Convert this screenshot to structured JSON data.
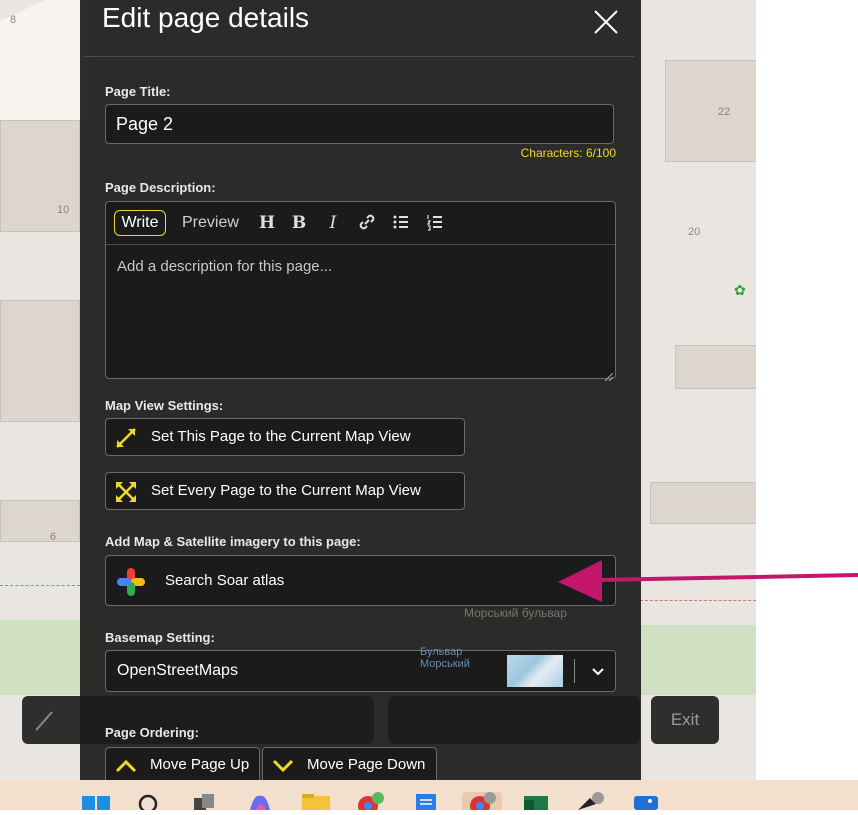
{
  "modal": {
    "title": "Edit page details",
    "page_title": {
      "label": "Page Title:",
      "value": "Page 2",
      "char_count": "Characters: 6/100"
    },
    "page_description": {
      "label": "Page Description:",
      "tab_write": "Write",
      "tab_preview": "Preview",
      "format_buttons": [
        "H",
        "B",
        "I",
        "link",
        "bulleted-list",
        "numbered-list"
      ],
      "placeholder": "Add a description for this page..."
    },
    "map_view": {
      "label": "Map View Settings:",
      "set_this_page": "Set This Page to the Current Map View",
      "set_every_page": "Set Every Page to the Current Map View"
    },
    "imagery": {
      "label": "Add Map & Satellite imagery to this page:",
      "search_button": "Search Soar atlas"
    },
    "basemap": {
      "label": "Basemap Setting:",
      "selected": "OpenStreetMaps"
    },
    "ordering": {
      "label": "Page Ordering:",
      "move_up": "Move Page Up",
      "move_down": "Move Page Down"
    }
  },
  "toolbar": {
    "exit_label": "Exit"
  },
  "map": {
    "building_numbers": [
      "8",
      "10",
      "6",
      "22",
      "20"
    ],
    "street_name": "Морський бульвар",
    "stop_name": "Бульвар Морський"
  },
  "colors": {
    "accent": "#eed926",
    "arrow": "#c2176b",
    "modal_bg": "#1c1c1c"
  }
}
